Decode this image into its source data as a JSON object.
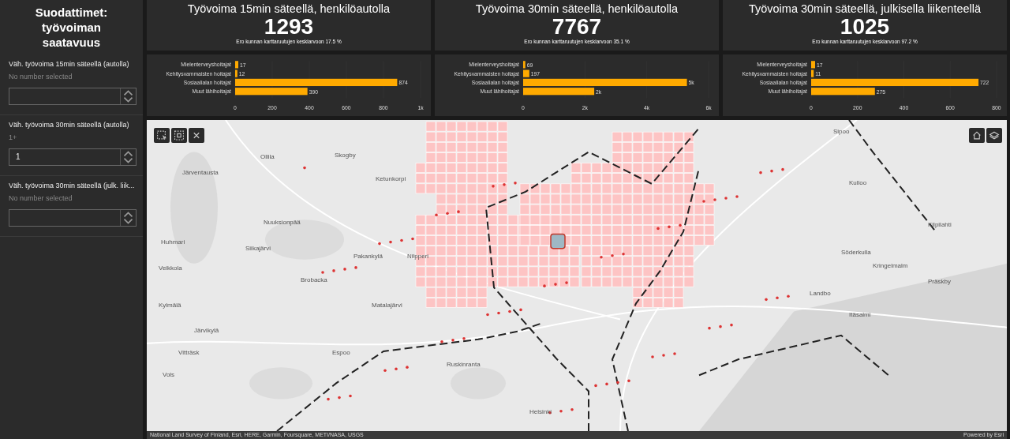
{
  "sidebar": {
    "title": "Suodattimet: työvoiman saatavuus",
    "filters": [
      {
        "label": "Väh. työvoima 15min säteellä (autolla)",
        "summary": "No number selected"
      },
      {
        "label": "Väh. työvoima 30min säteellä (autolla)",
        "summary": "1+",
        "value": "1"
      },
      {
        "label": "Väh. työvoima 30min säteellä (julk. liik...",
        "summary": "No number selected"
      }
    ]
  },
  "indicators": [
    {
      "title": "Työvoima 15min säteellä, henkilöautolla",
      "value": "1293",
      "note": "Ero kunnan karttaruutujen keskiarvoon 17.5 %"
    },
    {
      "title": "Työvoima 30min säteellä, henkilöautolla",
      "value": "7767",
      "note": "Ero kunnan karttaruutujen keskiarvoon 35.1 %"
    },
    {
      "title": "Työvoima 30min säteellä, julkisella liikenteellä",
      "value": "1025",
      "note": "Ero kunnan karttaruutujen keskiarvoon 97.2 %"
    }
  ],
  "charts": [
    {
      "chart_data": {
        "type": "bar",
        "orientation": "horizontal",
        "categories": [
          "Mielenterveyshoitajat",
          "Kehitysvammaisten hoitajat",
          "Sosiaalialan hoitajat",
          "Muut lähihoitajat"
        ],
        "series": [
          {
            "color": "#ffaa00",
            "values": [
              17,
              12,
              874,
              390
            ]
          }
        ],
        "xlim": [
          0,
          1000
        ],
        "xticks": [
          0,
          200,
          400,
          600,
          800,
          {
            "value": 1000,
            "label": "1k"
          }
        ],
        "value_labels": [
          "17",
          "12",
          "874",
          "390"
        ]
      }
    },
    {
      "chart_data": {
        "type": "bar",
        "orientation": "horizontal",
        "categories": [
          "Mielenterveyshoitajat",
          "Kehitysvammaisten hoitajat",
          "Sosiaalialan hoitajat",
          "Muut lähihoitajat"
        ],
        "series": [
          {
            "color": "#ffaa00",
            "values": [
              70,
              200,
              5300,
              2300
            ]
          }
        ],
        "xlim": [
          0,
          6000
        ],
        "xticks": [
          0,
          {
            "value": 2000,
            "label": "2k"
          },
          {
            "value": 4000,
            "label": "4k"
          },
          {
            "value": 6000,
            "label": "6k"
          }
        ],
        "value_labels": [
          "69",
          "197",
          "5k",
          "2k"
        ]
      }
    },
    {
      "chart_data": {
        "type": "bar",
        "orientation": "horizontal",
        "categories": [
          "Mielenterveyshoitajat",
          "Kehitysvammaisten hoitajat",
          "Sosiaalialan hoitajat",
          "Muut lähihoitajat"
        ],
        "series": [
          {
            "color": "#ffaa00",
            "values": [
              17,
              11,
              722,
              275
            ]
          }
        ],
        "xlim": [
          0,
          800
        ],
        "xticks": [
          0,
          200,
          400,
          600,
          800
        ],
        "value_labels": [
          "17",
          "11",
          "722",
          "275"
        ]
      }
    }
  ],
  "map": {
    "places": [
      "Sipoo",
      "Skogby",
      "Ollila",
      "Järventausta",
      "Ketunkorpi",
      "Kulloo",
      "Nuuksionpää",
      "Kilpilahti",
      "Huhmari",
      "Siikajärvi",
      "Söderkulla",
      "Pakankylä",
      "Nilpperi",
      "Kringelmalm",
      "Veikkola",
      "Brobacka",
      "Präskby",
      "Landbo",
      "Kylmälä",
      "Matalajärvi",
      "Itäsalmi",
      "Järvikylä",
      "Vitträsk",
      "Espoo",
      "Ruskinranta",
      "Vols",
      "Helsinki"
    ],
    "attribution": "National Land Survey of Finland, Esri, HERE, Garmin, Foursquare, METI/NASA, USGS",
    "powered_by": "Powered by Esri"
  }
}
